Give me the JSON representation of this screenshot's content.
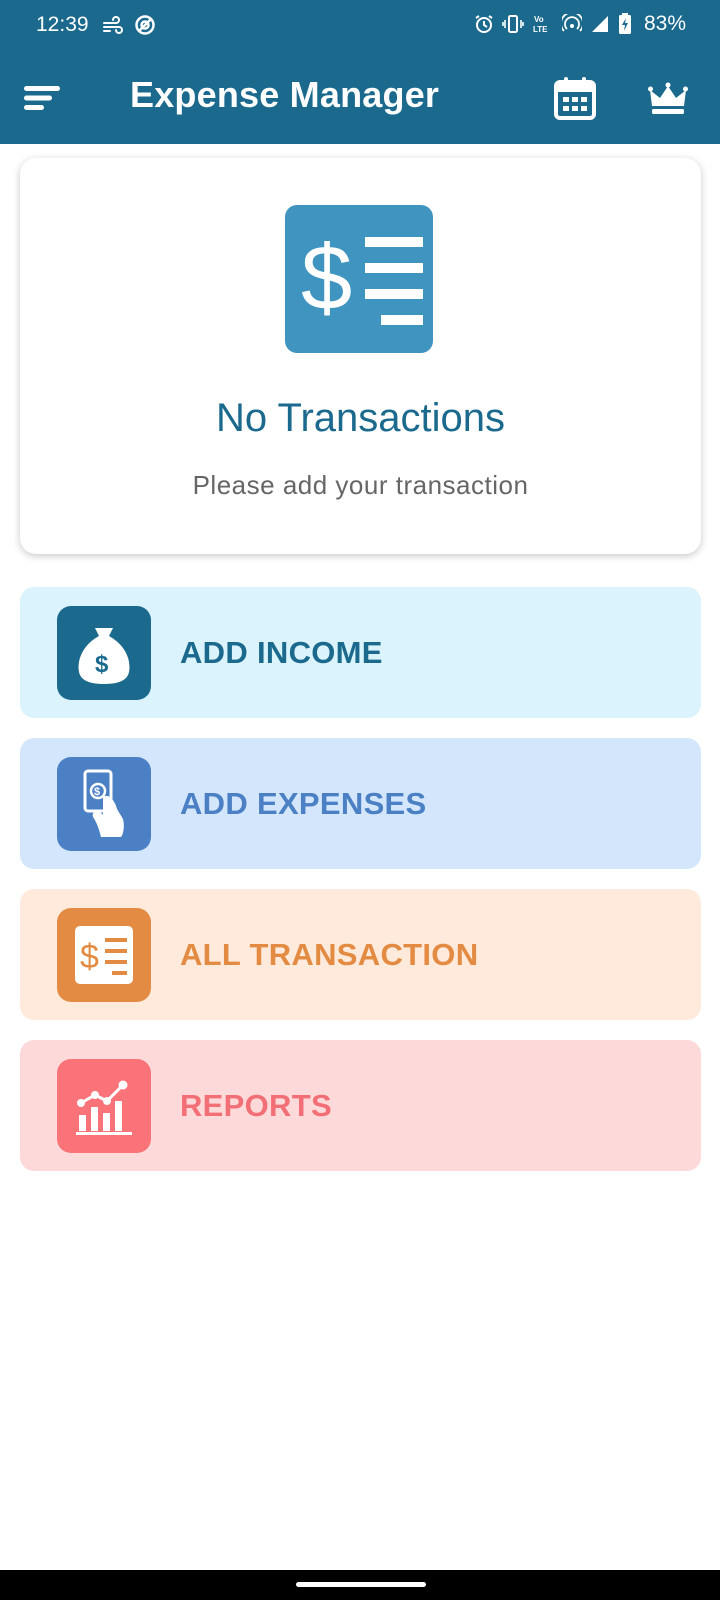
{
  "status_bar": {
    "time": "12:39",
    "battery": "83%",
    "left_icons": [
      "wind-icon",
      "location-off-icon"
    ],
    "right_icons": [
      "alarm-icon",
      "vibrate-icon",
      "volte-icon",
      "hotspot-icon",
      "signal-icon",
      "battery-charging-icon"
    ]
  },
  "app_bar": {
    "title": "Expense Manager",
    "left_icon": "menu-icon",
    "right_icons": [
      "calendar-icon",
      "crown-icon"
    ]
  },
  "empty_state": {
    "icon": "dollar-list-icon",
    "title": "No Transactions",
    "subtitle": "Please add your transaction"
  },
  "actions": [
    {
      "label": "ADD INCOME",
      "icon": "money-bag-icon",
      "color": "#1b6a8e",
      "bg": "#dbf3fc"
    },
    {
      "label": "ADD EXPENSES",
      "icon": "hand-money-icon",
      "color": "#4b80c4",
      "bg": "#d3e6fb"
    },
    {
      "label": "ALL TRANSACTION",
      "icon": "dollar-list-icon",
      "color": "#e38b42",
      "bg": "#ffeadc"
    },
    {
      "label": "REPORTS",
      "icon": "chart-icon",
      "color": "#fa7378",
      "bg": "#fdd9da"
    }
  ],
  "colors": {
    "primary": "#1b6a8e",
    "accent_icon": "#3f95bf"
  }
}
